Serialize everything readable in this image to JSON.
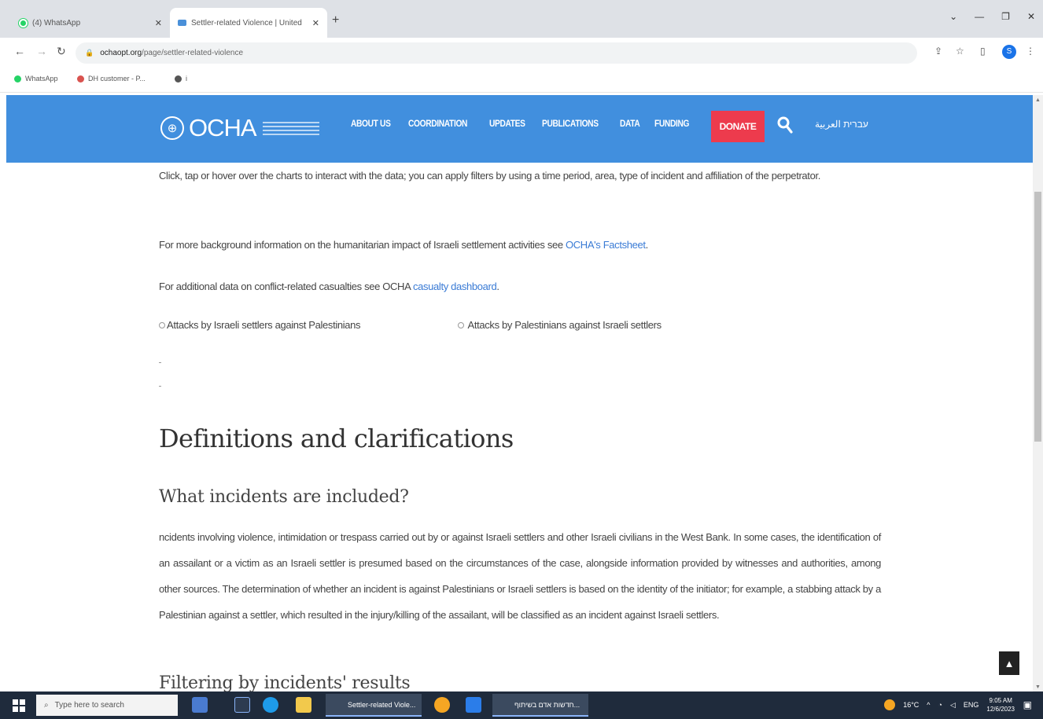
{
  "browser": {
    "tabs": [
      {
        "label": "(4) WhatsApp",
        "active": false
      },
      {
        "label": "Settler-related Violence | United",
        "active": true
      }
    ],
    "url_domain": "ochaopt.org",
    "url_path": "/page/settler-related-violence",
    "bookmarks": [
      "WhatsApp",
      "DH customer - P...",
      "i"
    ],
    "profile_initial": "S"
  },
  "site": {
    "logo_text": "OCHA",
    "nav": [
      "ABOUT US",
      "COORDINATION",
      "UPDATES",
      "PUBLICATIONS",
      "DATA",
      "FUNDING"
    ],
    "donate_label": "DONATE",
    "languages": "עברית العربية",
    "header_color": "#418fde",
    "donate_color": "#ed3b4d"
  },
  "content": {
    "intro": "Click, tap or hover over the charts to interact with the data; you can apply filters by using a time period, area, type of incident and affiliation of the perpetrator.",
    "background_prefix": "For more background information on the humanitarian impact of Israeli settlement activities see ",
    "background_link": "OCHA's Factsheet",
    "background_suffix": ".",
    "casualty_prefix": "For additional data on conflict-related casualties see OCHA ",
    "casualty_link": "casualty dashboard",
    "casualty_suffix": ".",
    "radio_options": [
      "Attacks by Israeli settlers against Palestinians",
      "Attacks by Palestinians against Israeli settlers"
    ],
    "definitions_heading": "Definitions and clarifications",
    "incidents_heading": "What incidents are included?",
    "incidents_text": "ncidents involving violence, intimidation or trespass carried out by or against Israeli settlers and other Israeli civilians in the West Bank. In some cases, the identification of an assailant or a victim as an Israeli settler is presumed based on the circumstances of the case, alongside information provided by witnesses and authorities, among other sources. The determination of whether an incident is against Palestinians or Israeli settlers is based on the identity of the initiator; for example, a stabbing attack by a Palestinian against a settler, which resulted in the injury/killing of the assailant, will be classified as an incident against Israeli settlers.",
    "filtering_heading": "Filtering by incidents' results"
  },
  "taskbar": {
    "search_placeholder": "Type here to search",
    "windows": [
      "Settler-related Viole...",
      "חדשות אדם בשיתוף..."
    ],
    "weather": "16°C",
    "language": "ENG",
    "time": "9:05 AM",
    "date": "12/6/2023"
  }
}
